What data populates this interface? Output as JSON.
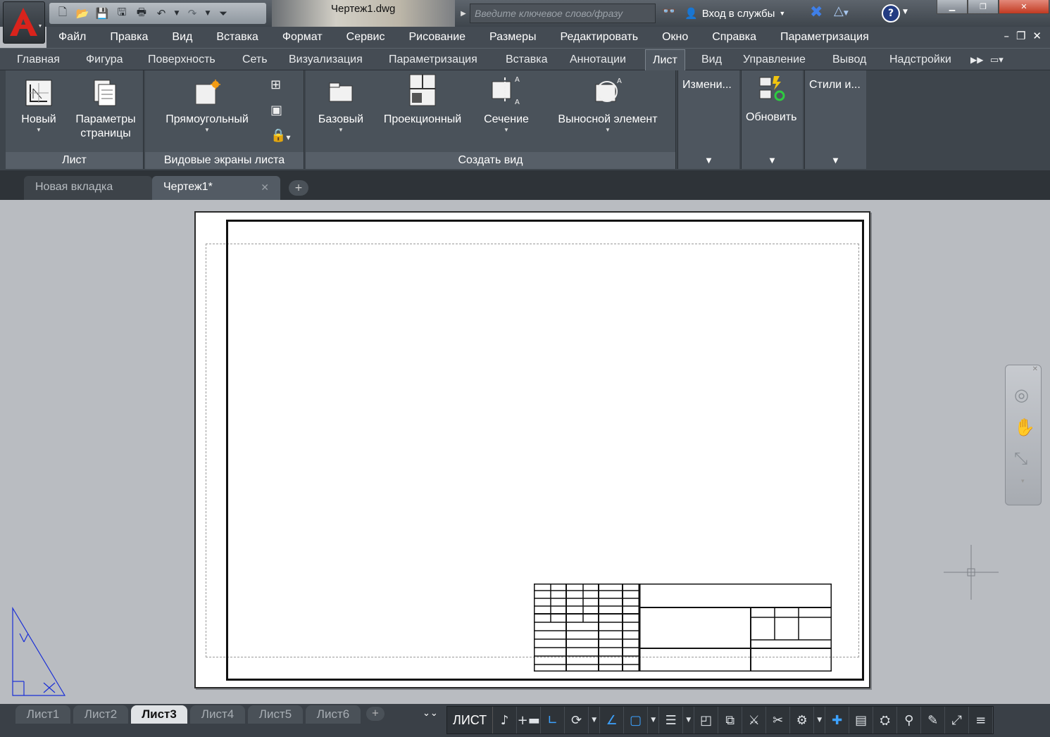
{
  "titlebar": {
    "document_title": "Чертеж1.dwg",
    "search_placeholder": "Введите ключевое слово/фразу",
    "signin_label": "Вход в службы",
    "help_label": "?"
  },
  "menubar": {
    "items": [
      "Файл",
      "Правка",
      "Вид",
      "Вставка",
      "Формат",
      "Сервис",
      "Рисование",
      "Размеры",
      "Редактировать",
      "Окно",
      "Справка",
      "Параметризация"
    ]
  },
  "ribbon_tabs": {
    "items": [
      "Главная",
      "Фигура",
      "Поверхность",
      "Сеть",
      "Визуализация",
      "Параметризация",
      "Вставка",
      "Аннотации",
      "Лист",
      "Вид",
      "Управление",
      "Вывод",
      "Надстройки"
    ],
    "active": "Лист"
  },
  "ribbon": {
    "panel_layout": {
      "title": "Лист",
      "new_label": "Новый",
      "page_setup_label_1": "Параметры",
      "page_setup_label_2": "страницы"
    },
    "panel_viewports": {
      "title": "Видовые экраны листа",
      "rect_label": "Прямоугольный"
    },
    "panel_create_view": {
      "title": "Создать вид",
      "base_label": "Базовый",
      "projected_label": "Проекционный",
      "section_label": "Сечение",
      "detail_label": "Выносной элемент"
    },
    "panel_modify": {
      "label": "Измени..."
    },
    "panel_update": {
      "label": "Обновить"
    },
    "panel_styles": {
      "label": "Стили и..."
    }
  },
  "file_tabs": {
    "new_tab": "Новая вкладка",
    "drawing_tab": "Чертеж1*",
    "close": "✕",
    "plus": "+"
  },
  "layout_tabs": {
    "items": [
      "Лист1",
      "Лист2",
      "Лист3",
      "Лист4",
      "Лист5",
      "Лист6"
    ],
    "active": "Лист3",
    "plus": "+"
  },
  "statusbar": {
    "space_label": "ЛИСТ"
  },
  "colors": {
    "accent": "#3da2ff",
    "app_logo_red": "#d9231c",
    "ribbon_bg": "#4a525a",
    "ucs_blue": "#1a2fd6"
  },
  "icons": [
    "app-logo-icon",
    "new-file-icon",
    "open-icon",
    "save-icon",
    "save-as-icon",
    "print-icon",
    "undo-icon",
    "redo-icon",
    "binoculars-icon",
    "user-icon",
    "exchange-icon",
    "a360-icon",
    "help-icon",
    "pan-icon",
    "zoom-icon",
    "steering-wheel-icon",
    "gear-icon",
    "plus-icon",
    "menu-icon"
  ]
}
